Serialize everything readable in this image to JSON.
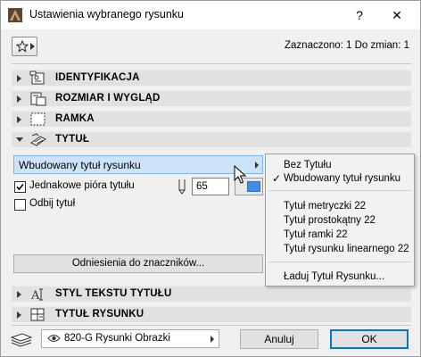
{
  "window": {
    "title": "Ustawienia wybranego rysunku",
    "help_label": "?",
    "close_label": "✕"
  },
  "toolbar": {
    "status": "Zaznaczono: 1 Do zmian: 1"
  },
  "sections": {
    "identification": "IDENTYFIKACJA",
    "size": "ROZMIAR I WYGLĄD",
    "frame": "RAMKA",
    "title": "TYTUŁ",
    "title_text_style": "STYL TEKSTU TYTUŁU",
    "drawing_title": "TYTUŁ RYSUNKU"
  },
  "title_panel": {
    "dropdown_value": "Wbudowany tytuł rysunku",
    "same_pens_label": "Jednakowe pióra tytułu",
    "same_pens_checked": true,
    "pen_value": "65",
    "pen_color": "#3d8fe6",
    "mirror_label": "Odbij tytuł",
    "mirror_checked": false,
    "references_button": "Odniesienia do znaczników..."
  },
  "popup": {
    "items": [
      {
        "label": "Bez Tytułu",
        "checked": false
      },
      {
        "label": "Wbudowany tytuł rysunku",
        "checked": true
      },
      {
        "label": "Tytuł metryczki 22",
        "checked": false
      },
      {
        "label": "Tytuł prostokątny 22",
        "checked": false
      },
      {
        "label": "Tytuł ramki 22",
        "checked": false
      },
      {
        "label": "Tytuł rysunku linearnego 22",
        "checked": false
      },
      {
        "label": "Ładuj Tytuł Rysunku...",
        "checked": false
      }
    ],
    "check_glyph": "✓"
  },
  "footer": {
    "layer": "820-G Rysunki Obrazki",
    "cancel_label": "Anuluj",
    "ok_label": "OK"
  },
  "colors": {
    "accent": "#0078d7",
    "selection": "#cce3f7",
    "section_bg": "#e1e1e1"
  },
  "icons": [
    "app-icon",
    "favorites-star-icon",
    "identification-icon",
    "size-icon",
    "frame-icon",
    "title-icon",
    "text-style-icon",
    "drawing-title-icon",
    "layer-eye-icon",
    "layers-stack-icon",
    "mouse-cursor-icon"
  ]
}
